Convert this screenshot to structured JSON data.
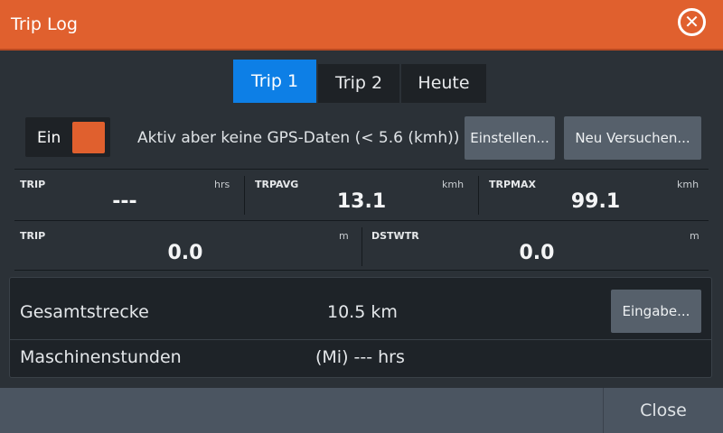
{
  "window": {
    "title": "Trip Log",
    "close_icon": "close-circle-icon"
  },
  "tabs": [
    {
      "label": "Trip 1",
      "active": true
    },
    {
      "label": "Trip 2",
      "active": false
    },
    {
      "label": "Heute",
      "active": false
    }
  ],
  "toggle": {
    "label": "Ein",
    "state": "on"
  },
  "status": {
    "text": "Aktiv aber keine GPS-Daten (< 5.6 (kmh))"
  },
  "buttons": {
    "einstellen": "Einstellen...",
    "neu_versuchen": "Neu Versuchen...",
    "eingabe": "Eingabe...",
    "close": "Close"
  },
  "grid": {
    "row1": [
      {
        "label": "TRIP",
        "unit": "hrs",
        "value": "---"
      },
      {
        "label": "TRPAVG",
        "unit": "kmh",
        "value": "13.1"
      },
      {
        "label": "TRPMAX",
        "unit": "kmh",
        "value": "99.1"
      }
    ],
    "row2": [
      {
        "label": "TRIP",
        "unit": "m",
        "value": "0.0"
      },
      {
        "label": "DSTWTR",
        "unit": "m",
        "value": "0.0"
      }
    ]
  },
  "summary": {
    "total_label": "Gesamtstrecke",
    "total_value": "10.5 km",
    "engine_label": "Maschinenstunden",
    "engine_value": "(Mi) --- hrs"
  },
  "colors": {
    "accent": "#e0602e",
    "tab_active": "#0d7fe6",
    "background": "#2b3137"
  }
}
